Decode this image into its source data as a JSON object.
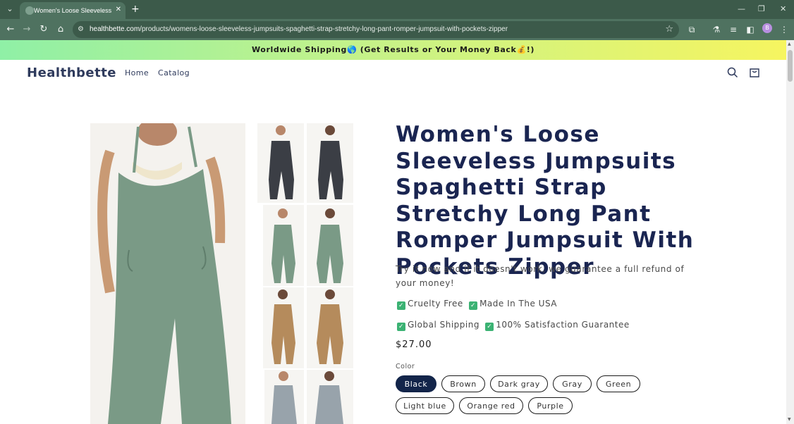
{
  "browser": {
    "tab_title": "Women's Loose Sleeveless Jum",
    "url_host": "healthbette.com",
    "url_path": "/products/womens-loose-sleeveless-jumpsuits-spaghetti-strap-stretchy-long-pant-romper-jumpsuit-with-pockets-zipper",
    "profile_initial": "B"
  },
  "announcement": "Worldwide Shipping🌎 (Get Results or Your Money Back💰!)",
  "header": {
    "logo": "Healthbette",
    "nav": [
      "Home",
      "Catalog"
    ]
  },
  "product": {
    "title": "Women's Loose Sleeveless Jumpsuits Spaghetti Strap Stretchy Long Pant Romper Jumpsuit With Pockets Zipper",
    "description": "Try it now and if it doesn't work, we guarantee a full refund of your money!",
    "features_row1": [
      "Cruelty Free",
      "Made In The USA"
    ],
    "features_row2": [
      "Global Shipping",
      "100% Satisfaction Guarantee"
    ],
    "price": "$27.00",
    "color_label": "Color",
    "colors": [
      "Black",
      "Brown",
      "Dark gray",
      "Gray",
      "Green",
      "Light blue",
      "Orange red",
      "Purple"
    ],
    "selected_color": "Black"
  },
  "icons": {
    "search": "search-icon",
    "cart": "cart-icon",
    "check": "check-icon"
  },
  "colors": {
    "title": "#1a2551",
    "selected_swatch": "#13254a",
    "check": "#3bb273"
  }
}
